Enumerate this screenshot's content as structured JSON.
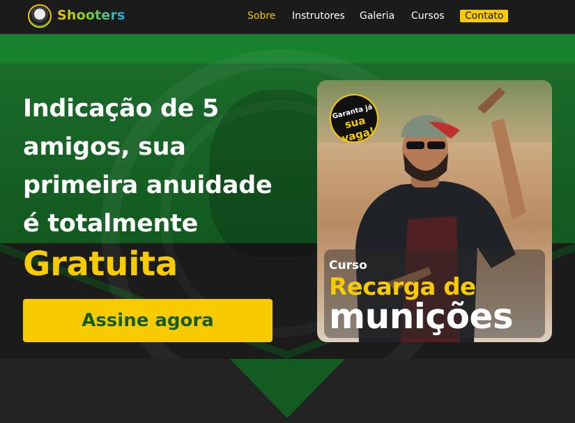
{
  "nav": {
    "logo_text": "Shooters",
    "items": [
      {
        "label": "Sobre",
        "active": true
      },
      {
        "label": "Instrutores",
        "active": false
      },
      {
        "label": "Galeria",
        "active": false
      },
      {
        "label": "Cursos",
        "active": false
      },
      {
        "label": "Contato",
        "active": false
      }
    ]
  },
  "hero": {
    "headline_lines": [
      "Indicação de 5",
      "amigos, sua",
      "primeira anuidade",
      "é totalmente"
    ],
    "highlight": "Gratuita",
    "cta_label": "Assine agora"
  },
  "course_card": {
    "badge_line1": "Garanta já",
    "badge_line2": "sua vaga!",
    "kicker": "Curso",
    "title_line1": "Recarga de",
    "title_line2": "munições"
  },
  "colors": {
    "accent_yellow": "#f7cb00",
    "hero_green": "#135c21",
    "dark_bg": "#1b1b1b"
  }
}
